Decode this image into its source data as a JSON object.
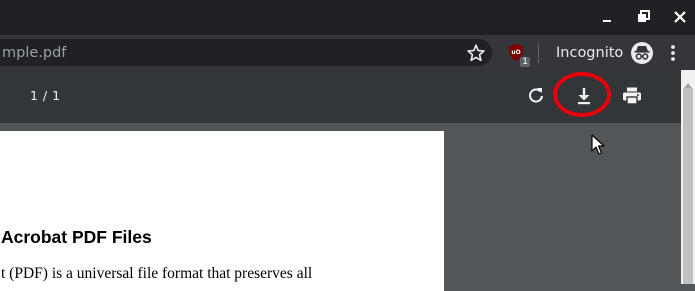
{
  "window": {
    "minimize_icon": "minimize-icon",
    "restore_icon": "restore-icon",
    "close_icon": "close-icon"
  },
  "omnibox": {
    "url": "mple.pdf",
    "bookmark_icon": "star-icon"
  },
  "extensions": {
    "ublock_icon": "ublock-origin-icon",
    "ublock_badge": "1"
  },
  "profile": {
    "label": "Incognito",
    "icon": "incognito-icon"
  },
  "menu_icon": "three-dot-menu-icon",
  "pdf_toolbar": {
    "page_indicator": "1 / 1",
    "rotate_icon": "rotate-icon",
    "download_icon": "download-icon",
    "print_icon": "print-icon"
  },
  "highlight_color": "#e8000b",
  "document": {
    "heading": "Acrobat PDF Files",
    "body_line": "t (PDF) is a universal file format that preserves all"
  }
}
